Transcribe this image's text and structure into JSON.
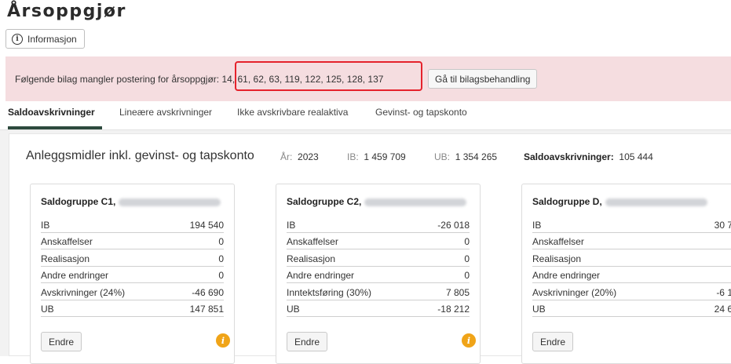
{
  "page": {
    "title": "Årsoppgjør"
  },
  "info_button": {
    "label": "Informasjon"
  },
  "alert": {
    "prefix": "Følgende bilag mangler postering for årsoppgjør:",
    "numbers": "14, 61, 62, 63, 119, 122, 125, 128, 137",
    "button": "Gå til bilagsbehandling",
    "colors": {
      "background": "#f5dde0",
      "highlight": "#e5222c"
    }
  },
  "tabs": [
    {
      "label": "Saldoavskrivninger",
      "active": true
    },
    {
      "label": "Lineære avskrivninger",
      "active": false
    },
    {
      "label": "Ikke avskrivbare realaktiva",
      "active": false
    },
    {
      "label": "Gevinst- og tapskonto",
      "active": false
    }
  ],
  "summary": {
    "title": "Anleggsmidler inkl. gevinst- og tapskonto",
    "year_label": "År:",
    "year": "2023",
    "ib_label": "IB:",
    "ib": "1 459 709",
    "ub_label": "UB:",
    "ub": "1 354 265",
    "depr_label": "Saldoavskrivninger:",
    "depr": "105 444"
  },
  "cards": [
    {
      "title": "Saldogruppe C1,",
      "rows": [
        {
          "label": "IB",
          "value": "194 540"
        },
        {
          "label": "Anskaffelser",
          "value": "0"
        },
        {
          "label": "Realisasjon",
          "value": "0"
        },
        {
          "label": "Andre endringer",
          "value": "0"
        },
        {
          "label": "Avskrivninger (24%)",
          "value": "-46 690"
        },
        {
          "label": "UB",
          "value": "147 851"
        }
      ],
      "button": "Endre"
    },
    {
      "title": "Saldogruppe C2,",
      "rows": [
        {
          "label": "IB",
          "value": "-26 018"
        },
        {
          "label": "Anskaffelser",
          "value": "0"
        },
        {
          "label": "Realisasjon",
          "value": "0"
        },
        {
          "label": "Andre endringer",
          "value": "0"
        },
        {
          "label": "Inntektsføring (30%)",
          "value": "7 805"
        },
        {
          "label": "UB",
          "value": "-18 212"
        }
      ],
      "button": "Endre"
    },
    {
      "title": "Saldogruppe D,",
      "rows": [
        {
          "label": "IB",
          "value": "30 7"
        },
        {
          "label": "Anskaffelser",
          "value": ""
        },
        {
          "label": "Realisasjon",
          "value": ""
        },
        {
          "label": "Andre endringer",
          "value": ""
        },
        {
          "label": "Avskrivninger (20%)",
          "value": "-6 1"
        },
        {
          "label": "UB",
          "value": "24 6"
        }
      ],
      "button": "Endre"
    }
  ],
  "icons": {
    "info": "info-circle-icon",
    "warning": "warning-info-icon",
    "warning_color": "#f0a418"
  }
}
